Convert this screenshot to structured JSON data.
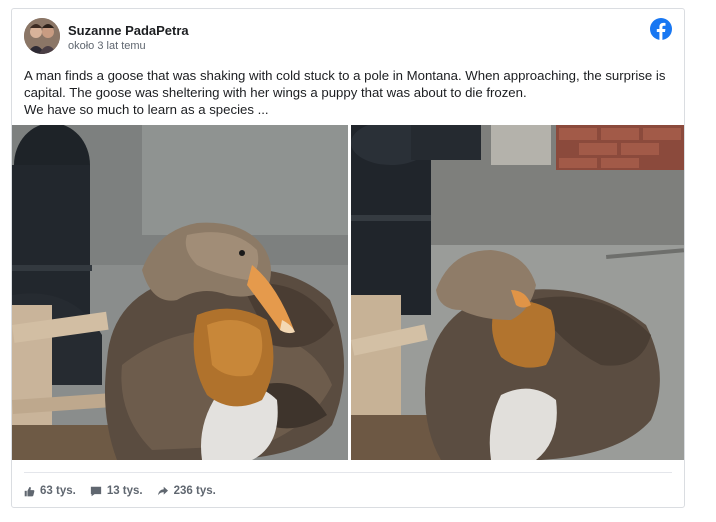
{
  "post": {
    "author": "Suzanne PadaPetra",
    "time": "około 3 lat temu",
    "text_lines": [
      "A man finds a goose that was shaking with cold stuck to a pole in Montana. When approaching, the surprise is capital. The goose was sheltering with her wings a puppy that was about to die frozen.",
      "We have so much to learn as a species ..."
    ]
  },
  "stats": {
    "likes": "63 tys.",
    "comments": "13 tys.",
    "shares": "236 tys."
  },
  "icons": {
    "brand": "facebook-icon",
    "like": "thumbs-up-icon",
    "comment": "comment-icon",
    "share": "share-arrow-icon"
  },
  "colors": {
    "facebook_blue": "#1877f2",
    "meta_gray": "#606770"
  }
}
